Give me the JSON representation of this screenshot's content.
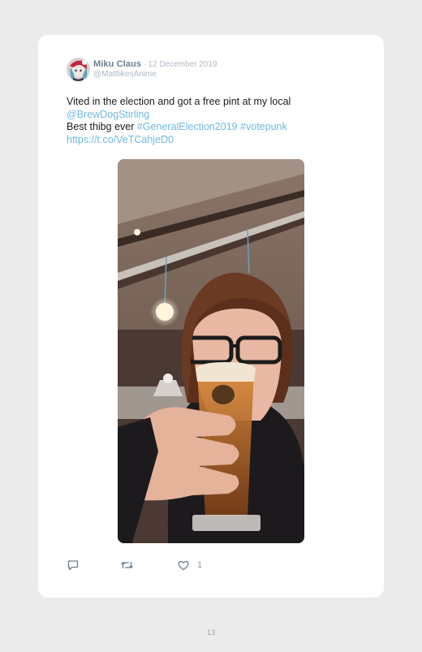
{
  "tweet": {
    "display_name": "Miku Claus",
    "separator": "·",
    "date": "12 December 2019",
    "handle": "@MattlikesAnime",
    "text_line1": "Vited in the election and got a free pint at my local",
    "mention": "@BrewDogStirling",
    "text_line3_prefix": "Best thibg ever ",
    "hashtag1": "#GeneralElection2019",
    "hashtag_gap": " ",
    "hashtag2": "#votepunk",
    "link": "https://t.co/VeTCahjeD0"
  },
  "actions": {
    "reply_icon": "reply-icon",
    "retweet_icon": "retweet-icon",
    "like_icon": "heart-icon",
    "like_count": "1"
  },
  "footer": {
    "page_number": "13"
  },
  "colors": {
    "background": "#ebebeb",
    "card": "#ffffff",
    "name": "#6a7d90",
    "meta": "#b0bac4",
    "link": "#6fb8e0",
    "icon": "#6a7d90"
  }
}
